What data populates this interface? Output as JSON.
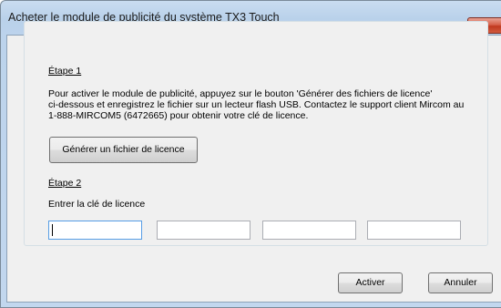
{
  "window": {
    "title": "Acheter le module de publicité du système TX3 Touch",
    "close_glyph": "✕"
  },
  "step1": {
    "heading": "Étape 1",
    "description_lines": [
      "Pour activer le module de publicité, appuyez sur le bouton 'Générer des fichiers de licence'",
      "ci-dessous et enregistrez le fichier sur un lecteur flash USB. Contactez le support client Mircom au",
      "1-888-MIRCOM5 (6472665) pour obtenir votre clé de licence."
    ],
    "generate_button_label": "Générer un fichier de licence"
  },
  "step2": {
    "heading": "Étape 2",
    "prompt": "Entrer la clé de licence",
    "key_fields": [
      {
        "value": ""
      },
      {
        "value": ""
      },
      {
        "value": ""
      },
      {
        "value": ""
      }
    ]
  },
  "footer": {
    "activate_label": "Activer",
    "cancel_label": "Annuler"
  },
  "icons": {
    "close": "close-icon"
  }
}
